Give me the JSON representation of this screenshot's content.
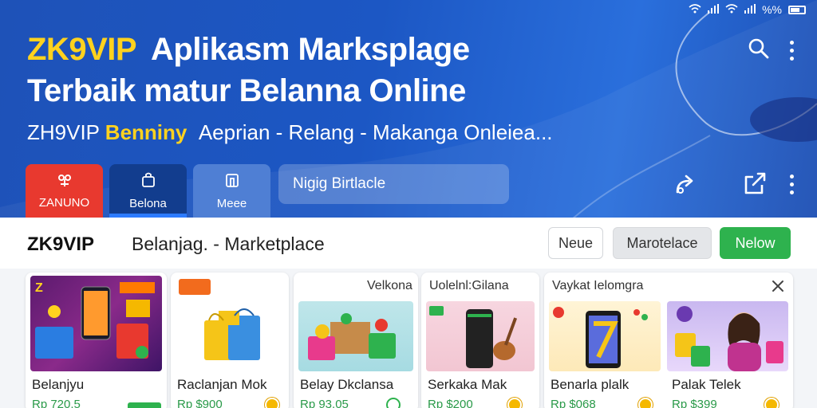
{
  "status_bar": {
    "battery_text": "%%"
  },
  "hero": {
    "brand": "ZK9VIP",
    "title_line1": "Aplikasm Marksplage",
    "title_line2": "Terbaik matur Belanna Online",
    "subtitle_prefix": "ZH9VIP",
    "subtitle_highlight": "Benniny",
    "subtitle_rest": "Aeprian - Relang - Makanga Onleiea...",
    "buttons": [
      {
        "label": "ZANUNO",
        "icon": "gift-icon",
        "color": "#e8392f"
      },
      {
        "label": "Belona",
        "icon": "bag-icon",
        "color": "#123d8e"
      },
      {
        "label": "Meee",
        "icon": "store-icon",
        "color": "#4f7fd4"
      }
    ],
    "search_placeholder": "Nigig Birtlacle"
  },
  "toolbar": {
    "brand": "ZK9VIP",
    "subtitle": "Belanjag.  -  Marketplace",
    "btn_neue": "Neue",
    "btn_market": "Marotelace",
    "btn_new": "Nelow"
  },
  "cards": [
    {
      "title": "Belanjyu",
      "price": "Rp 720.5",
      "image": "phone-shopping-banner"
    },
    {
      "title": "Raclanjan Mok",
      "price": "Rp $900",
      "image": "shopping-bags"
    },
    {
      "header": "Velkona",
      "title": "Belay Dkclansa",
      "price": "Rp 93.05",
      "image": "grocery-box"
    },
    {
      "header": "Uolelnl:Gilana",
      "title": "Serkaka Mak",
      "price": "Rp $200",
      "image": "speaker-guitar"
    },
    {
      "header": "Vaykat Ielomgra",
      "title": "Benarla plalk",
      "price": "Rp $068",
      "image": "smartphone"
    },
    {
      "title": "Palak Telek",
      "price": "Rp $399",
      "image": "woman-shopping"
    }
  ],
  "colors": {
    "hero_blue": "#1e52b8",
    "accent_yellow": "#ffd21e",
    "accent_red": "#e8392f",
    "accent_green": "#2eb24e"
  }
}
